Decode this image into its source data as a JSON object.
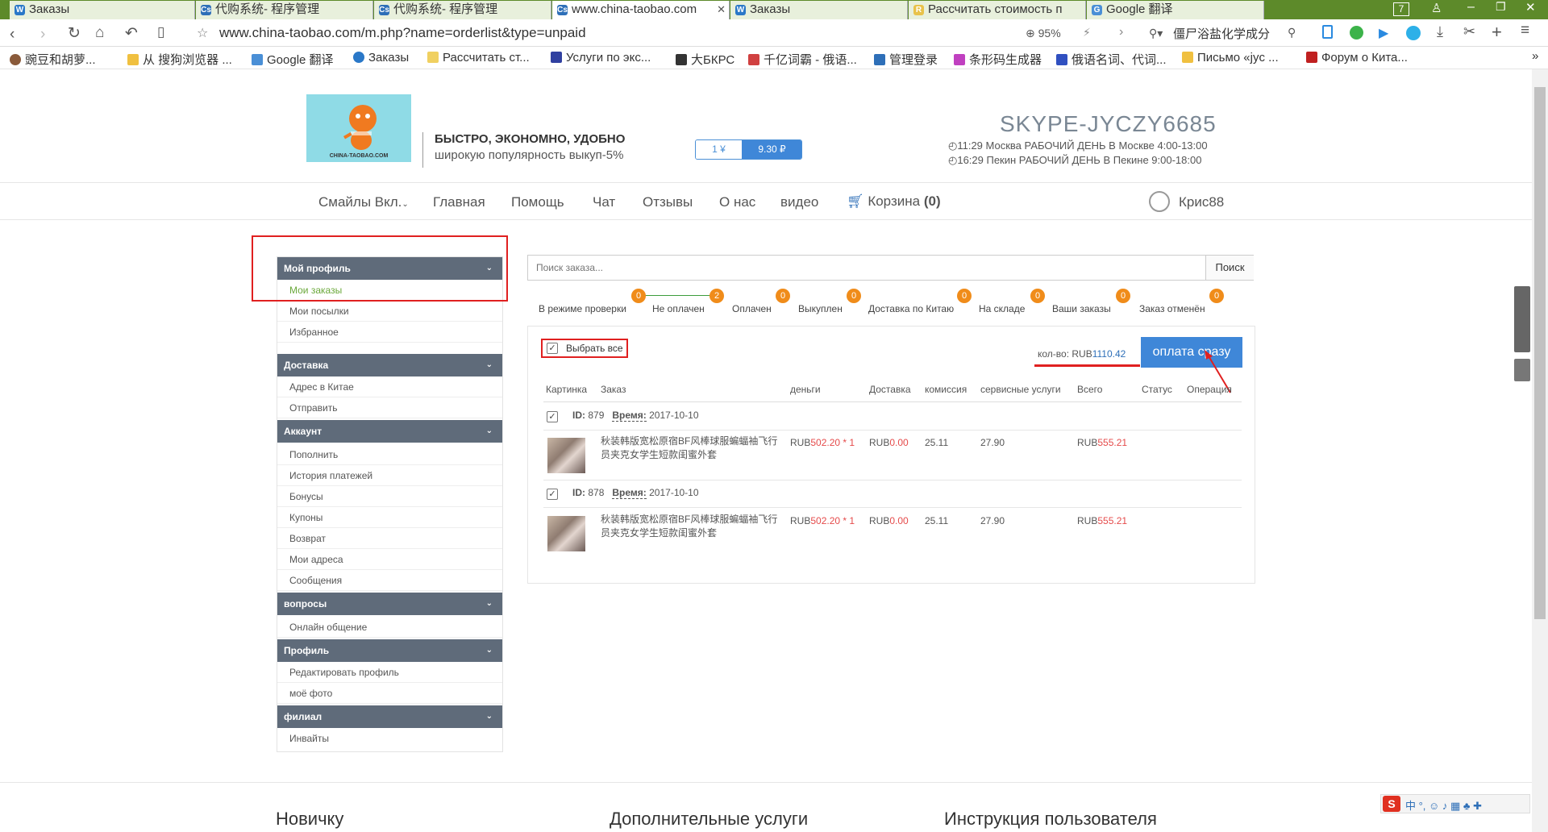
{
  "tabs": [
    {
      "label": "Заказы",
      "icon": "W"
    },
    {
      "label": "代购系统- 程序管理",
      "icon": "Cs"
    },
    {
      "label": "代购系统- 程序管理",
      "icon": "Cs"
    },
    {
      "label": "www.china-taobao.com",
      "icon": "Cs"
    },
    {
      "label": "Заказы",
      "icon": "W"
    },
    {
      "label": "Рассчитать стоимость п",
      "icon": "R"
    },
    {
      "label": "Google 翻译",
      "icon": "G"
    }
  ],
  "tab_counter": "7",
  "address": {
    "url": "www.china-taobao.com/m.php?name=orderlist&type=unpaid",
    "zoom": "95%",
    "search_text": "僵尸浴盐化学成分"
  },
  "bookmarks": [
    "豌豆和胡萝...",
    "从 搜狗浏览器 ...",
    "Google 翻译",
    "Заказы",
    "Рассчитать ст...",
    "Услуги по экс...",
    "大БКРС",
    "千亿词霸 - 俄语...",
    "管理登录",
    "条形码生成器",
    "俄语名词、代词...",
    "Письмо «jyc ...",
    "Форум о Кита..."
  ],
  "header": {
    "logo_text": "CHINA-TAOBAO.COM",
    "slogan_title": "БЫСТРО, ЭКОНОМНО, УДОБНО",
    "slogan_sub": "широкую популярность выкуп-5%",
    "rate_left": "1 ¥",
    "rate_right": "9.30 ₽",
    "skype": "SKYPE-JYCZY6685",
    "time1": "◴11:29  Москва   РАБОЧИЙ ДЕНЬ В Москве 4:00-13:00",
    "time2": "◴16:29  Пекин    РАБОЧИЙ ДЕНЬ В Пекине 9:00-18:00"
  },
  "nav": {
    "smiles": "Смайлы Вкл.",
    "home": "Главная",
    "help": "Помощь",
    "chat": "Чат",
    "reviews": "Отзывы",
    "about": "О нас",
    "video": "видео",
    "cart": "Корзина",
    "cart_count": "(0)",
    "user": "Крис88"
  },
  "sidebar": {
    "sections": [
      {
        "title": "Мой профиль",
        "items": [
          "Мои заказы",
          "Мои посылки",
          "Избранное"
        ]
      },
      {
        "title": "Доставка",
        "items": [
          "Адрес в Китае",
          "Отправить"
        ]
      },
      {
        "title": "Аккаунт",
        "items": [
          "Пополнить",
          "История платежей",
          "Бонусы",
          "Купоны",
          "Возврат",
          "Мои адреса",
          "Сообщения"
        ]
      },
      {
        "title": "вопросы",
        "items": [
          "Онлайн общение"
        ]
      },
      {
        "title": "Профиль",
        "items": [
          "Редактировать профиль",
          "моё фото"
        ]
      },
      {
        "title": "филиал",
        "items": [
          "Инвайты"
        ]
      }
    ]
  },
  "search": {
    "placeholder": "Поиск заказа...",
    "button": "Поиск"
  },
  "filters": [
    {
      "label": "В режиме проверки",
      "count": "0"
    },
    {
      "label": "Не оплачен",
      "count": "2"
    },
    {
      "label": "Оплачен",
      "count": "0"
    },
    {
      "label": "Выкуплен",
      "count": "0"
    },
    {
      "label": "Доставка по Китаю",
      "count": "0"
    },
    {
      "label": "На складе",
      "count": "0"
    },
    {
      "label": "Ваши заказы",
      "count": "0"
    },
    {
      "label": "Заказ отменён",
      "count": "0"
    }
  ],
  "orders_panel": {
    "select_all": "Выбрать все",
    "total_label": "кол-во: RUB",
    "total_value": "1110.42",
    "pay_button": "оплата сразу",
    "columns": [
      "Картинка",
      "Заказ",
      "деньги",
      "Доставка",
      "комиссия",
      "сервисные услуги",
      "Всего",
      "Статус",
      "Операция"
    ],
    "orders": [
      {
        "id_label": "ID:",
        "id": "879",
        "time_label": "Время:",
        "time": "2017-10-10",
        "title": "秋装韩版宽松原宿BF风棒球服蝙蝠袖飞行员夹克女学生短款闺蜜外套",
        "price_cur": "RUB",
        "price": "502.20",
        "qty": " * 1",
        "ship_cur": "RUB",
        "ship": "0.00",
        "commission": "25.11",
        "service": "27.90",
        "total_cur": "RUB",
        "total": "555.21"
      },
      {
        "id_label": "ID:",
        "id": "878",
        "time_label": "Время:",
        "time": "2017-10-10",
        "title": "秋装韩版宽松原宿BF风棒球服蝙蝠袖飞行员夹克女学生短款闺蜜外套",
        "price_cur": "RUB",
        "price": "502.20",
        "qty": " * 1",
        "ship_cur": "RUB",
        "ship": "0.00",
        "commission": "25.11",
        "service": "27.90",
        "total_cur": "RUB",
        "total": "555.21"
      }
    ]
  },
  "footer": {
    "col1": "Новичку",
    "col2": "Дополнительные услуги",
    "col3": "Инструкция пользователя"
  },
  "colors": {
    "accent": "#4a8fd6",
    "badge": "#f08c1a",
    "annotation": "#e02020",
    "sidebar_header": "#5f6b7a"
  }
}
